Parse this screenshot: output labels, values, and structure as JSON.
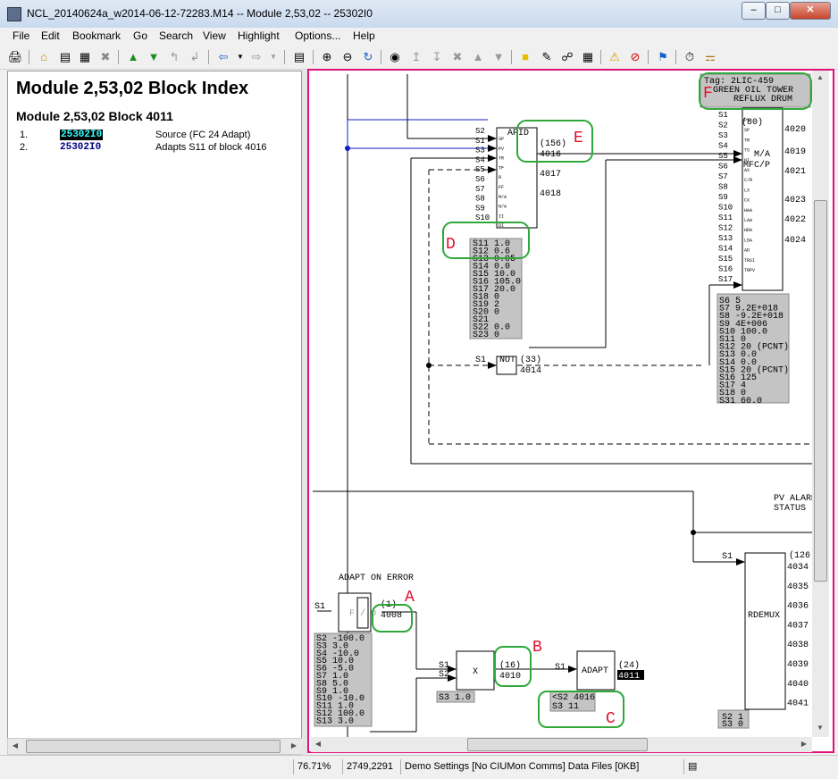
{
  "window": {
    "title": "NCL_20140624a_w2014-06-12-72283.M14 -- Module 2,53,02 -- 25302I0",
    "minimize": "–",
    "maximize": "□",
    "close": "✕"
  },
  "menu": [
    "File",
    "Edit",
    "Bookmark",
    "Go",
    "Search",
    "View",
    "Highlight",
    "Options...",
    "Help"
  ],
  "toolbar_icons": [
    "print-icon",
    "home-icon",
    "index-icon",
    "report-icon",
    "delete-icon",
    "up-icon",
    "down-icon",
    "up-left-icon",
    "down-left-icon",
    "back-icon",
    "dropdown-icon",
    "forward-icon",
    "dropdown-icon",
    "window-icon",
    "zoom-in-icon",
    "zoom-out-icon",
    "refresh-icon",
    "binoculars-icon",
    "find-up-icon",
    "find-down-icon",
    "find-prev-icon",
    "find-next-icon",
    "find-x-icon",
    "find-up-arrow-icon",
    "find-down-arrow-icon",
    "note-icon",
    "edit-icon",
    "link-icon",
    "keyboard-icon",
    "warning-icon",
    "no-icon",
    "flag-icon",
    "timer-icon",
    "lock-icon"
  ],
  "left": {
    "module_title": "Module 2,53,02 Block Index",
    "block_title": "Module 2,53,02 Block 4011",
    "rows": [
      {
        "num": "1.",
        "tag": "25302I0",
        "desc": "Source (FC 24 Adapt)"
      },
      {
        "num": "2.",
        "tag": "25302I0",
        "desc": "Adapts S11 of block 4016"
      }
    ]
  },
  "diagram": {
    "tag_box": [
      "Tag: 2LIC-459",
      "GREEN OIL TOWER",
      "REFLUX DRUM"
    ],
    "callouts": {
      "A": "A",
      "B": "B",
      "C": "C",
      "D": "D",
      "E": "E",
      "F": "F"
    },
    "pid": {
      "name": "APID",
      "num": "(156)",
      "out": "4016",
      "o2": "4017",
      "o3": "4018",
      "inputs": [
        "S2",
        "S1",
        "S3",
        "S4",
        "S5",
        "S6",
        "S7",
        "S8",
        "S9",
        "S10"
      ],
      "pins": [
        "SP",
        "PV",
        "TR",
        "TF",
        "R",
        "FF",
        "M/A",
        "N/A",
        "II",
        "DI"
      ],
      "params": [
        "S11 1.0",
        "S12 0.6",
        "S13 0.05",
        "S14 0.0",
        "S15 10.0",
        "S16 105.0",
        "S17 20.0",
        "S18 0",
        "S19 2",
        "S20 0",
        "S21",
        "S22 0.0",
        "S23 0"
      ]
    },
    "mfc": {
      "name": "M/A",
      "sub": "MFC/P",
      "num": "(80)",
      "outs": [
        "4020",
        "4019",
        "4021",
        "4023",
        "4022",
        "4024"
      ],
      "inputs": [
        "S1",
        "S2",
        "S3",
        "S4",
        "S5",
        "S6",
        "S7",
        "S8",
        "S9",
        "S10",
        "S11",
        "S12",
        "S13",
        "S14",
        "S15",
        "S16",
        "S17"
      ],
      "pins": [
        "PV",
        "SP",
        "TR",
        "TS",
        "NI",
        "AX",
        "C/R",
        "LX",
        "CX",
        "HAA",
        "LAA",
        "HDA",
        "LDA",
        "AD",
        "TRSI",
        "TRPV"
      ],
      "params": [
        "S6 5",
        "S7 9.2E+018",
        "S8 -9.2E+018",
        "S9 4E+006",
        "S10 100.0",
        "S11 0",
        "S12 20 (PCNT)",
        "S13 0.0",
        "S14 0.0",
        "S15 20 (PCNT)",
        "S16 125",
        "S17 4",
        "S18 0",
        "S31 60.0"
      ]
    },
    "not": {
      "name": "NOT",
      "num": "(33)",
      "out": "4014",
      "input": "S1"
    },
    "pv_alarm": [
      "PV ALARM",
      "STATUS"
    ],
    "rdemux": {
      "name": "RDEMUX",
      "num": "(126)",
      "input": "S1",
      "outs": [
        "4034",
        "4035",
        "4036",
        "4037",
        "4038",
        "4039",
        "4040",
        "4041"
      ],
      "params": [
        "S2 1",
        "S3 0"
      ]
    },
    "adapt_err": {
      "label": "ADAPT ON ERROR",
      "num": "(1)",
      "out": "4008",
      "input": "S1",
      "sym": "F / O",
      "params": [
        "S2 -100.0",
        "S3 3.0",
        "S4 -10.0",
        "S5 10.0",
        "S6 -5.0",
        "S7 1.0",
        "S8 5.0",
        "S9 1.0",
        "S10 -10.0",
        "S11 1.0",
        "S12 100.0",
        "S13 3.0"
      ]
    },
    "mult": {
      "name": "X",
      "num": "(16)",
      "out": "4010",
      "in1": "S1",
      "in2": "S2",
      "param": "S3 1.0"
    },
    "adapt": {
      "name": "ADAPT",
      "num": "(24)",
      "out": "4011",
      "input": "S1",
      "params": [
        "<S2 4016",
        "S3 11"
      ]
    }
  },
  "status": {
    "zoom": "76.71%",
    "coords": "2749,2291",
    "info": "Demo Settings [No CIUMon Comms] Data Files [0KB]"
  }
}
